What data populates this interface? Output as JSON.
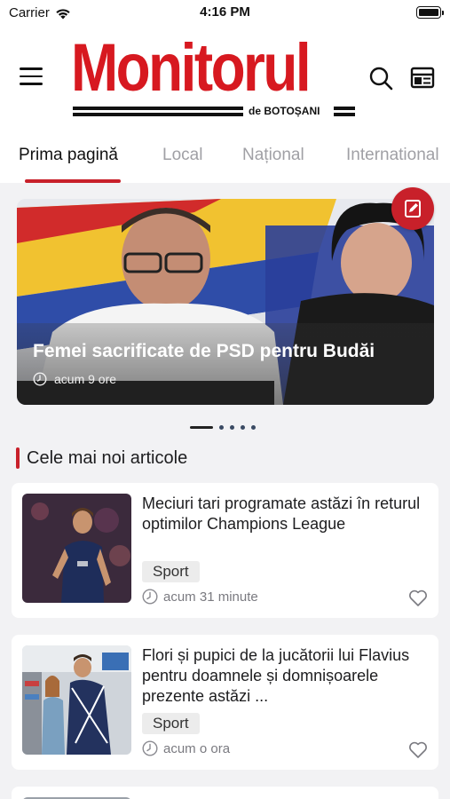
{
  "status_bar": {
    "carrier": "Carrier",
    "time": "4:16 PM"
  },
  "header": {
    "logo_text": "Monitorul",
    "logo_sub": "de BOTOȘANI",
    "brand_color": "#d71920",
    "icons": [
      "menu-icon",
      "search-icon",
      "newspaper-icon"
    ]
  },
  "tabs": [
    {
      "label": "Prima pagină",
      "active": true
    },
    {
      "label": "Local",
      "active": false
    },
    {
      "label": "Național",
      "active": false
    },
    {
      "label": "International",
      "active": false
    }
  ],
  "accent_color": "#c8202a",
  "hero": {
    "title": "Femei sacrificate de PSD pentru Budăi",
    "time": "acum 9 ore",
    "slides_total": 5,
    "slide_active": 1
  },
  "section": {
    "title": "Cele mai noi articole"
  },
  "articles": [
    {
      "title": "Meciuri tari programate astăzi în returul optimilor Champions League",
      "category": "Sport",
      "time": "acum 31 minute"
    },
    {
      "title": "Flori și pupici de la jucătorii lui Flavius pentru doamnele și domnișoarele prezente astăzi ...",
      "category": "Sport",
      "time": "acum o ora"
    }
  ]
}
